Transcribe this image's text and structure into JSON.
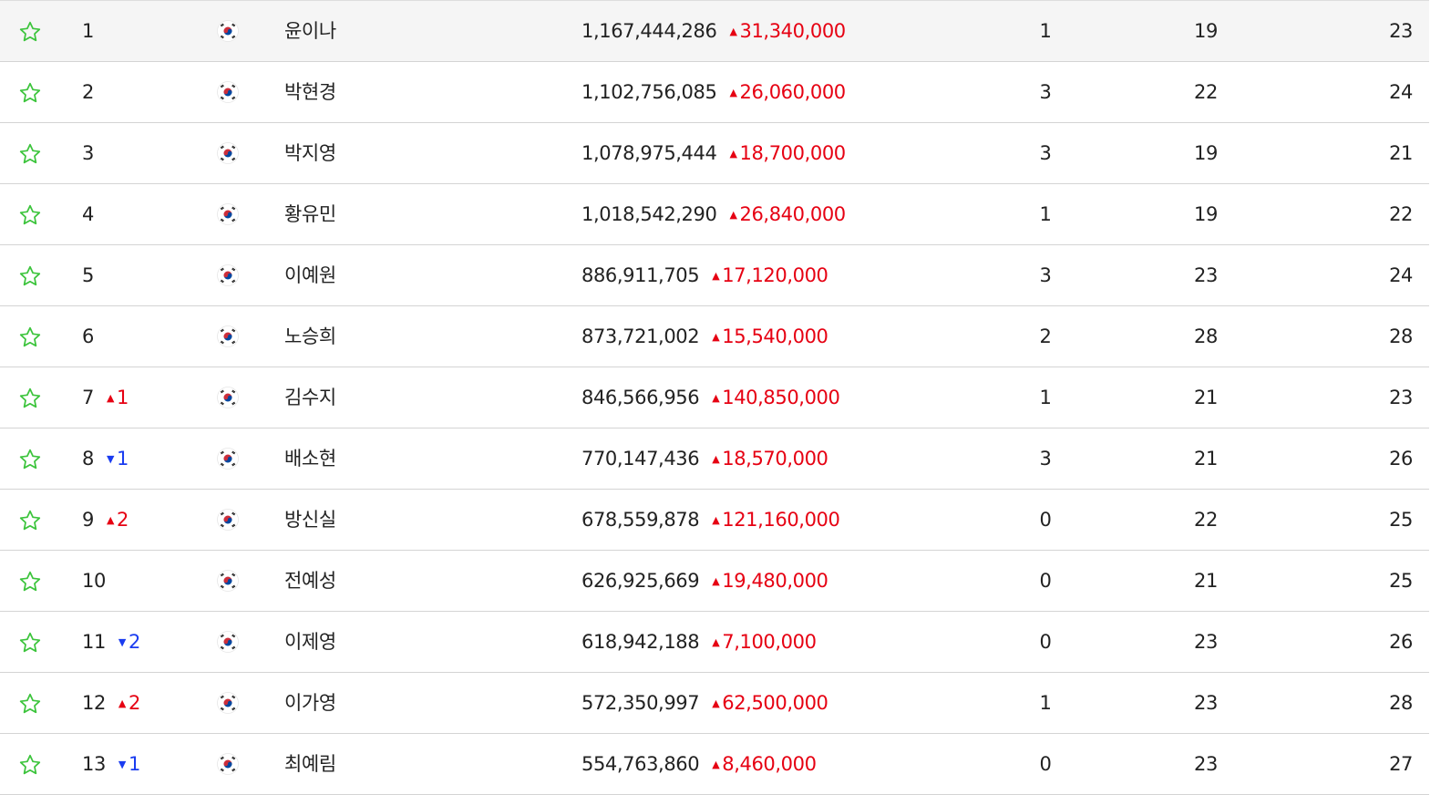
{
  "colors": {
    "star": "#3cc43c",
    "up": "#e60012",
    "down": "#1a3cf0",
    "highlight_row": "#f5f5f5"
  },
  "icons": {
    "favorite": "star-outline-icon",
    "flag": "korea-flag-icon",
    "up": "▲",
    "down": "▼"
  },
  "rows": [
    {
      "rank": "1",
      "delta_dir": "",
      "delta": "",
      "name": "윤이나",
      "prize": "1,167,444,286",
      "gain": "31,340,000",
      "c1": "1",
      "c2": "19",
      "c3": "23"
    },
    {
      "rank": "2",
      "delta_dir": "",
      "delta": "",
      "name": "박현경",
      "prize": "1,102,756,085",
      "gain": "26,060,000",
      "c1": "3",
      "c2": "22",
      "c3": "24"
    },
    {
      "rank": "3",
      "delta_dir": "",
      "delta": "",
      "name": "박지영",
      "prize": "1,078,975,444",
      "gain": "18,700,000",
      "c1": "3",
      "c2": "19",
      "c3": "21"
    },
    {
      "rank": "4",
      "delta_dir": "",
      "delta": "",
      "name": "황유민",
      "prize": "1,018,542,290",
      "gain": "26,840,000",
      "c1": "1",
      "c2": "19",
      "c3": "22"
    },
    {
      "rank": "5",
      "delta_dir": "",
      "delta": "",
      "name": "이예원",
      "prize": "886,911,705",
      "gain": "17,120,000",
      "c1": "3",
      "c2": "23",
      "c3": "24"
    },
    {
      "rank": "6",
      "delta_dir": "",
      "delta": "",
      "name": "노승희",
      "prize": "873,721,002",
      "gain": "15,540,000",
      "c1": "2",
      "c2": "28",
      "c3": "28"
    },
    {
      "rank": "7",
      "delta_dir": "up",
      "delta": "1",
      "name": "김수지",
      "prize": "846,566,956",
      "gain": "140,850,000",
      "c1": "1",
      "c2": "21",
      "c3": "23"
    },
    {
      "rank": "8",
      "delta_dir": "down",
      "delta": "1",
      "name": "배소현",
      "prize": "770,147,436",
      "gain": "18,570,000",
      "c1": "3",
      "c2": "21",
      "c3": "26"
    },
    {
      "rank": "9",
      "delta_dir": "up",
      "delta": "2",
      "name": "방신실",
      "prize": "678,559,878",
      "gain": "121,160,000",
      "c1": "0",
      "c2": "22",
      "c3": "25"
    },
    {
      "rank": "10",
      "delta_dir": "",
      "delta": "",
      "name": "전예성",
      "prize": "626,925,669",
      "gain": "19,480,000",
      "c1": "0",
      "c2": "21",
      "c3": "25"
    },
    {
      "rank": "11",
      "delta_dir": "down",
      "delta": "2",
      "name": "이제영",
      "prize": "618,942,188",
      "gain": "7,100,000",
      "c1": "0",
      "c2": "23",
      "c3": "26"
    },
    {
      "rank": "12",
      "delta_dir": "up",
      "delta": "2",
      "name": "이가영",
      "prize": "572,350,997",
      "gain": "62,500,000",
      "c1": "1",
      "c2": "23",
      "c3": "28"
    },
    {
      "rank": "13",
      "delta_dir": "down",
      "delta": "1",
      "name": "최예림",
      "prize": "554,763,860",
      "gain": "8,460,000",
      "c1": "0",
      "c2": "23",
      "c3": "27"
    }
  ]
}
